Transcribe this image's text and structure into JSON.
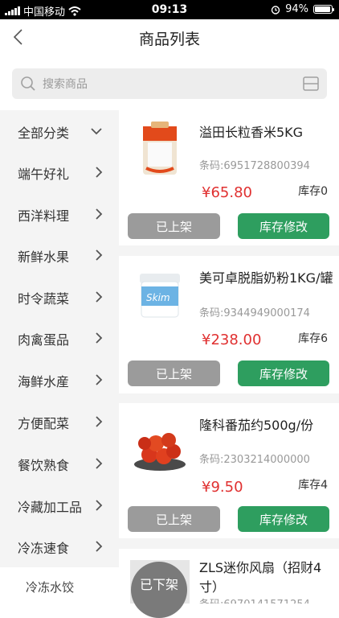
{
  "status_bar": {
    "carrier": "中国移动",
    "time": "09:13",
    "battery": "94%",
    "battery_level": 0.94
  },
  "nav": {
    "title": "商品列表"
  },
  "search": {
    "placeholder": "搜索商品"
  },
  "sidebar": {
    "items": [
      {
        "label": "全部分类",
        "expanded": true
      },
      {
        "label": "端午好礼"
      },
      {
        "label": "西洋料理"
      },
      {
        "label": "新鲜水果"
      },
      {
        "label": "时令蔬菜"
      },
      {
        "label": "肉禽蛋品"
      },
      {
        "label": "海鲜水産"
      },
      {
        "label": "方便配菜"
      },
      {
        "label": "餐饮熟食"
      },
      {
        "label": "冷藏加工品"
      },
      {
        "label": "冷冻速食"
      }
    ],
    "sub_item": "冷冻水饺"
  },
  "products": [
    {
      "name": "溢田长粒香米5KG",
      "code": "条码:6951728800394",
      "price": "¥65.80",
      "stock": "库存0",
      "status_button": "已上架",
      "edit_button": "库存修改"
    },
    {
      "name": "美可卓脱脂奶粉1KG/罐",
      "code": "条码:9344949000174",
      "price": "¥238.00",
      "stock": "库存6",
      "status_button": "已上架",
      "edit_button": "库存修改"
    },
    {
      "name": "隆科番茄约500g/份",
      "code": "条码:2303214000000",
      "price": "¥9.50",
      "stock": "库存4",
      "status_button": "已上架",
      "edit_button": "库存修改"
    },
    {
      "name": "ZLS迷你风扇（招财4寸）",
      "code": "条码:6970141571254"
    }
  ],
  "float_button": "已下架",
  "colors": {
    "accent_green": "#2e9e5f",
    "price_red": "#e03030",
    "button_gray": "#9b9b9b"
  }
}
